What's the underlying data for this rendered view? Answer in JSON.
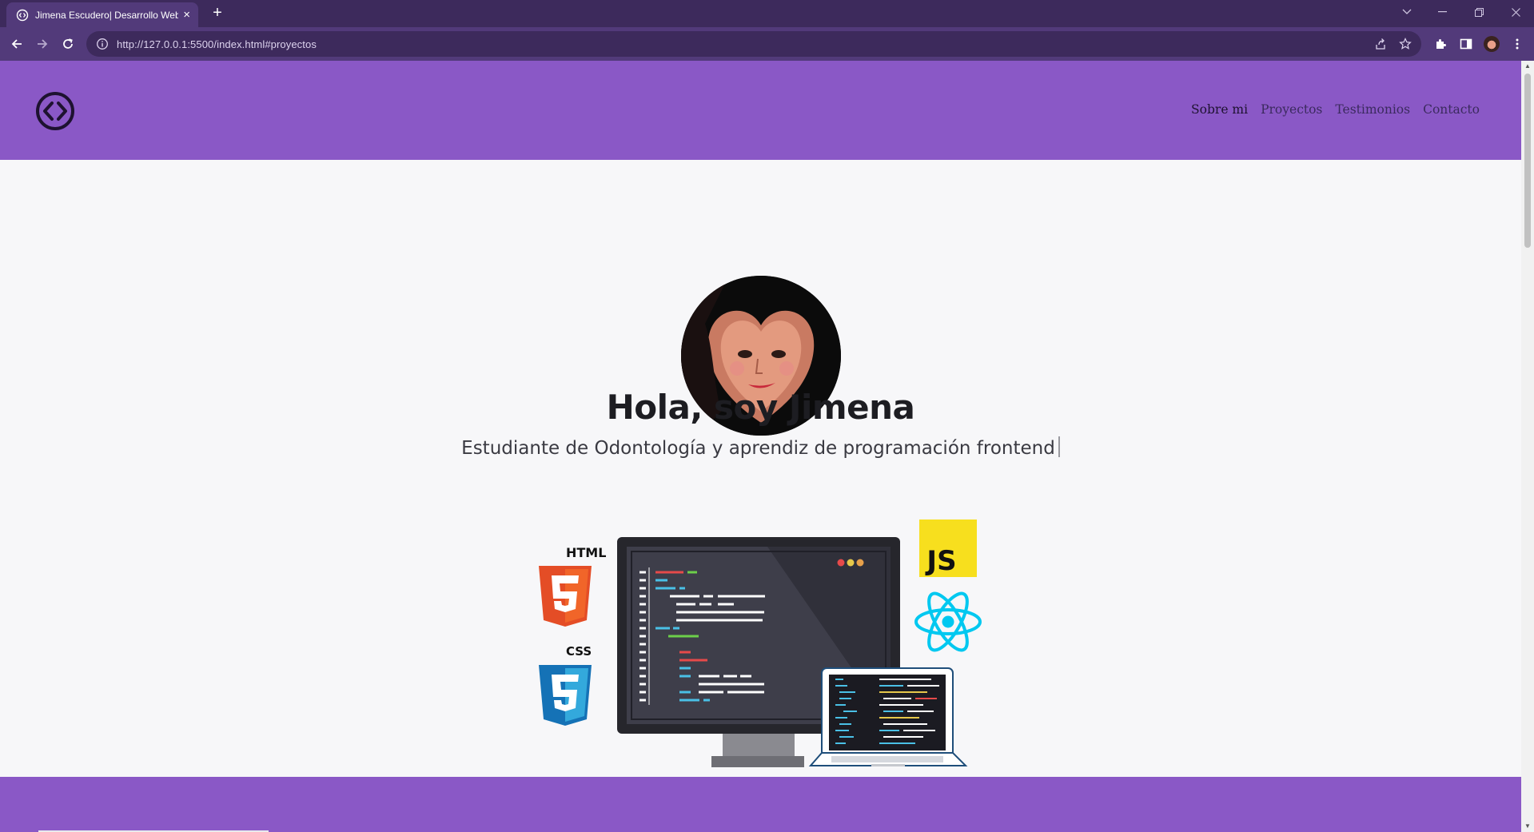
{
  "browser": {
    "tab_title": "Jimena Escudero| Desarrollo Web",
    "url_host": "http://127.0.0.1",
    "url_rest": ":5500/index.html#proyectos",
    "new_tab_label": "+",
    "tab_close_label": "×"
  },
  "site": {
    "logo_icon": "code-brackets-icon",
    "nav": [
      {
        "label": "Sobre mi"
      },
      {
        "label": "Proyectos"
      },
      {
        "label": "Testimonios"
      },
      {
        "label": "Contacto"
      }
    ]
  },
  "hero": {
    "title": "Hola, soy Jimena",
    "subtitle": "Estudiante de Odontología y aprendiz de programación frontend",
    "badges": {
      "html": "HTML",
      "css": "CSS",
      "js": "JS"
    }
  },
  "colors": {
    "header": "#8a58c6",
    "chrome_tabbar": "#3d2a5c",
    "chrome_toolbar": "#523a7a"
  }
}
